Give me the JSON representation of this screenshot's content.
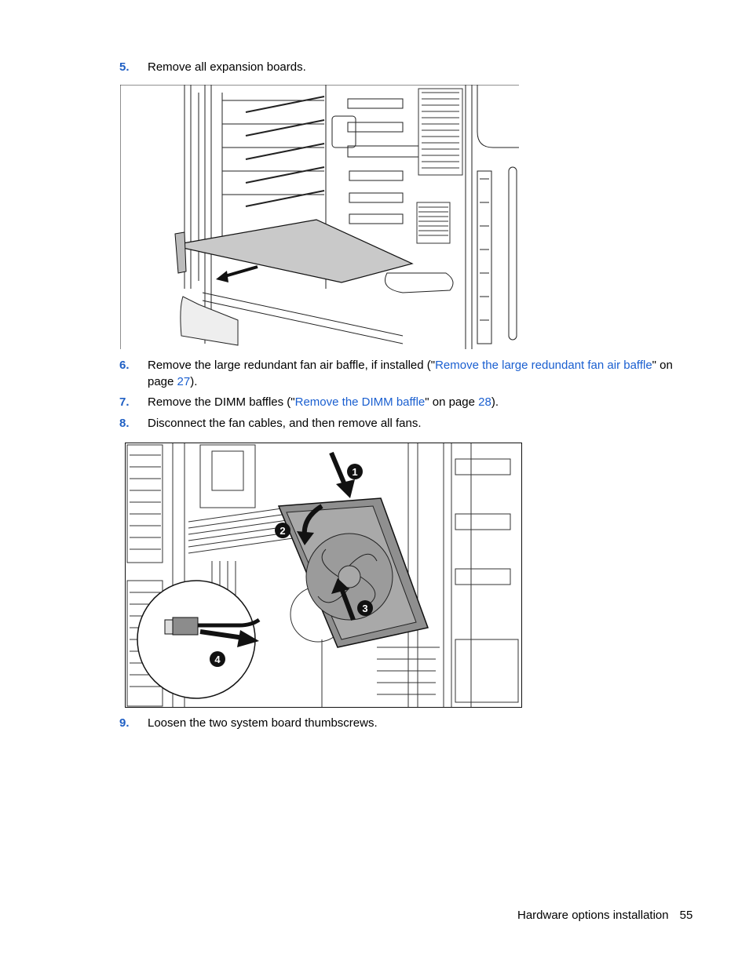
{
  "steps": [
    {
      "num": "5.",
      "text": "Remove all expansion boards."
    },
    {
      "num": "6.",
      "pre": "Remove the large redundant fan air baffle, if installed (\"",
      "link": "Remove the large redundant fan air baffle",
      "mid": "\" on",
      "line2_pre": "page ",
      "page_link": "27",
      "post": ")."
    },
    {
      "num": "7.",
      "pre": "Remove the DIMM baffles (\"",
      "link": "Remove the DIMM baffle",
      "mid": "\" on page ",
      "page_link": "28",
      "post": ")."
    },
    {
      "num": "8.",
      "text": "Disconnect the fan cables, and then remove all fans."
    },
    {
      "num": "9.",
      "text": "Loosen the two system board thumbscrews."
    }
  ],
  "figures": {
    "expansion_board": {
      "label": "Expansion board removal illustration"
    },
    "fan_removal": {
      "label": "Fan removal illustration",
      "callouts": [
        "1",
        "2",
        "3",
        "4"
      ]
    }
  },
  "footer": {
    "section": "Hardware options installation",
    "page": "55"
  },
  "colors": {
    "step_number": "#1f5fc4",
    "link": "#1a5fd0"
  }
}
